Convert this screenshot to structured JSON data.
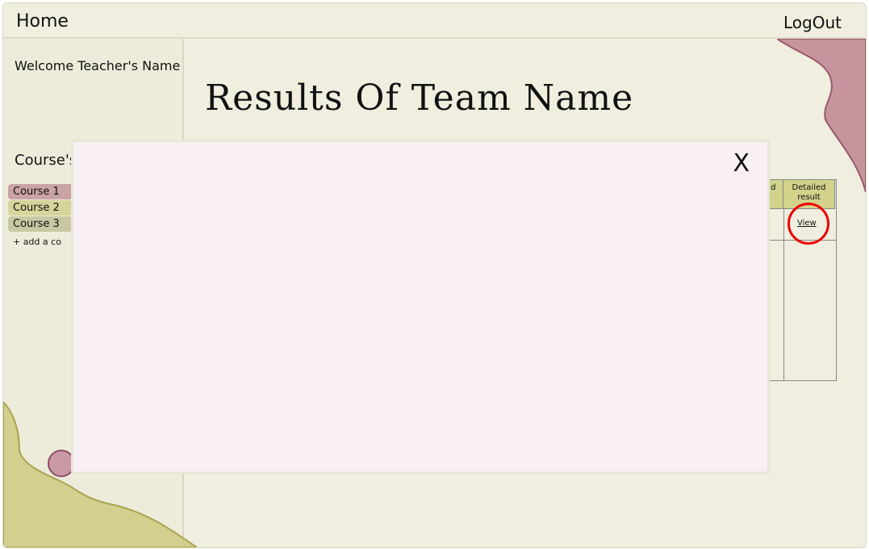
{
  "header": {
    "home_label": "Home",
    "logout_label": "LogOut"
  },
  "sidebar": {
    "welcome_text": "Welcome Teacher's Name",
    "courses_heading": "Course's",
    "courses": [
      "Course 1",
      "Course 2",
      "Course 3"
    ],
    "add_course_label": "+ add a co"
  },
  "main": {
    "title": "Results Of Team Name"
  },
  "table": {
    "headers": [
      "ho d",
      "Detailed result"
    ],
    "view_link": "View"
  },
  "modal": {
    "close_label": "X"
  },
  "colors": {
    "background": "#efeedf",
    "modal_bg": "#f9f0f5",
    "accent_pink": "#c98f9c",
    "accent_olive": "#c8c477",
    "highlight": "#e00000"
  }
}
